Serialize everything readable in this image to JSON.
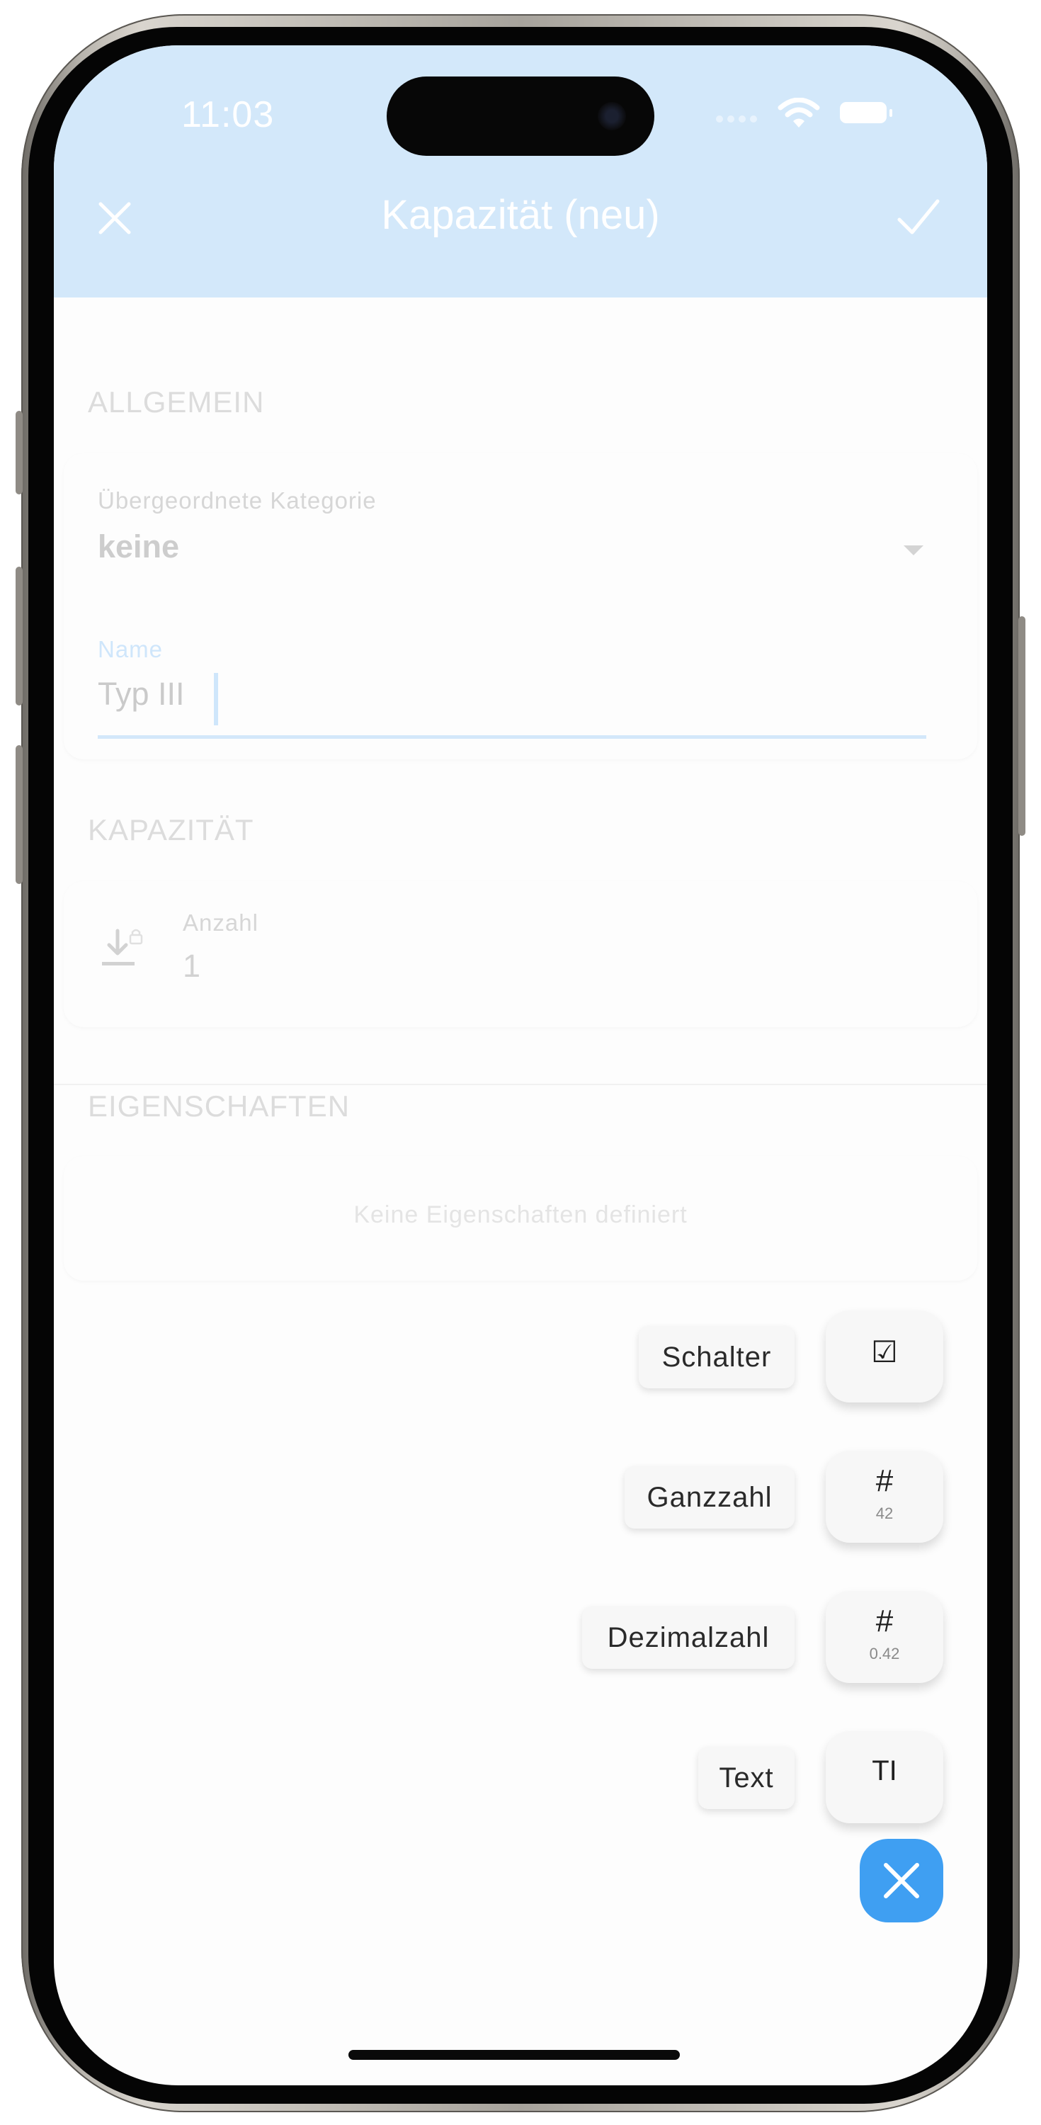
{
  "status_bar": {
    "time": "11:03"
  },
  "app_bar": {
    "title": "Kapazität (neu)"
  },
  "sections": {
    "general": {
      "header": "ALLGEMEIN",
      "parent_category": {
        "label": "Übergeordnete Kategorie",
        "value": "keine"
      },
      "name": {
        "label": "Name",
        "value": "Typ III"
      }
    },
    "capacity": {
      "header": "KAPAZITÄT",
      "count": {
        "label": "Anzahl",
        "value": "1"
      }
    },
    "properties": {
      "header": "EIGENSCHAFTEN",
      "empty_text": "Keine Eigenschaften definiert"
    }
  },
  "speed_dial": {
    "items": [
      {
        "label": "Schalter",
        "glyph": "☑",
        "sub": ""
      },
      {
        "label": "Ganzzahl",
        "glyph": "#",
        "sub": "42"
      },
      {
        "label": "Dezimalzahl",
        "glyph": "#",
        "sub": "0.42"
      },
      {
        "label": "Text",
        "glyph": "TI",
        "sub": ""
      }
    ]
  },
  "colors": {
    "app_bar": "#d3e8fa",
    "accent": "#3f9ff2",
    "focus_underline": "#d3e8fa",
    "background": "#fdfdfd"
  },
  "icons": {
    "close": "close-icon",
    "confirm": "checkmark-icon",
    "dropdown": "dropdown-arrow-icon",
    "count": "download-lock-icon",
    "fab_close": "close-icon"
  }
}
